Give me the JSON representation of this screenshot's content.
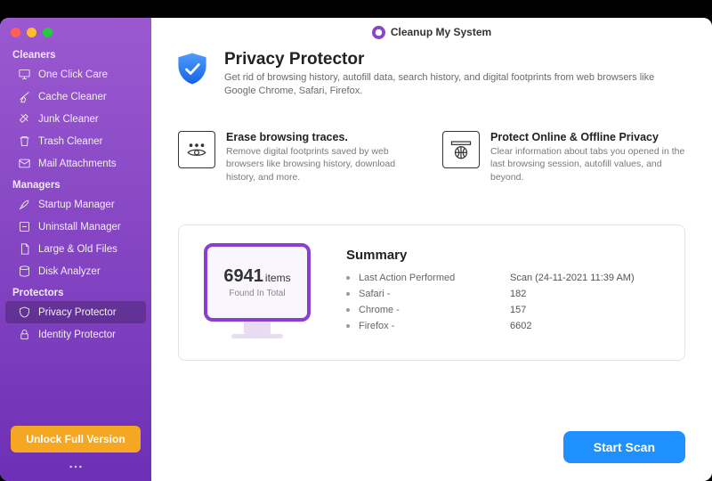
{
  "app": {
    "title": "Cleanup My System"
  },
  "sidebar": {
    "sections": {
      "cleaners": {
        "label": "Cleaners",
        "items": [
          {
            "label": "One Click Care"
          },
          {
            "label": "Cache Cleaner"
          },
          {
            "label": "Junk Cleaner"
          },
          {
            "label": "Trash Cleaner"
          },
          {
            "label": "Mail Attachments"
          }
        ]
      },
      "managers": {
        "label": "Managers",
        "items": [
          {
            "label": "Startup Manager"
          },
          {
            "label": "Uninstall Manager"
          },
          {
            "label": "Large & Old Files"
          },
          {
            "label": "Disk Analyzer"
          }
        ]
      },
      "protectors": {
        "label": "Protectors",
        "items": [
          {
            "label": "Privacy Protector"
          },
          {
            "label": "Identity Protector"
          }
        ]
      }
    },
    "unlock_label": "Unlock Full Version"
  },
  "header": {
    "title": "Privacy Protector",
    "subtitle": "Get rid of browsing history, autofill data, search history, and digital footprints from web browsers like Google Chrome, Safari, Firefox."
  },
  "features": [
    {
      "title": "Erase browsing traces.",
      "desc": "Remove digital footprints saved by web browsers like browsing history, download history, and more."
    },
    {
      "title": "Protect Online & Offline Privacy",
      "desc": "Clear information about tabs you opened in the last browsing session, autofill values, and beyond."
    }
  ],
  "summary": {
    "count": "6941",
    "count_unit": "items",
    "count_subtitle": "Found In Total",
    "heading": "Summary",
    "rows": [
      {
        "label": "Last Action Performed",
        "value": "Scan (24-11-2021 11:39 AM)"
      },
      {
        "label": "Safari -",
        "value": "182"
      },
      {
        "label": "Chrome -",
        "value": "157"
      },
      {
        "label": "Firefox -",
        "value": "6602"
      }
    ]
  },
  "actions": {
    "start_scan": "Start Scan"
  },
  "colors": {
    "accent_purple": "#8a3fd1",
    "accent_orange": "#f5a623",
    "accent_blue": "#1e90ff"
  }
}
